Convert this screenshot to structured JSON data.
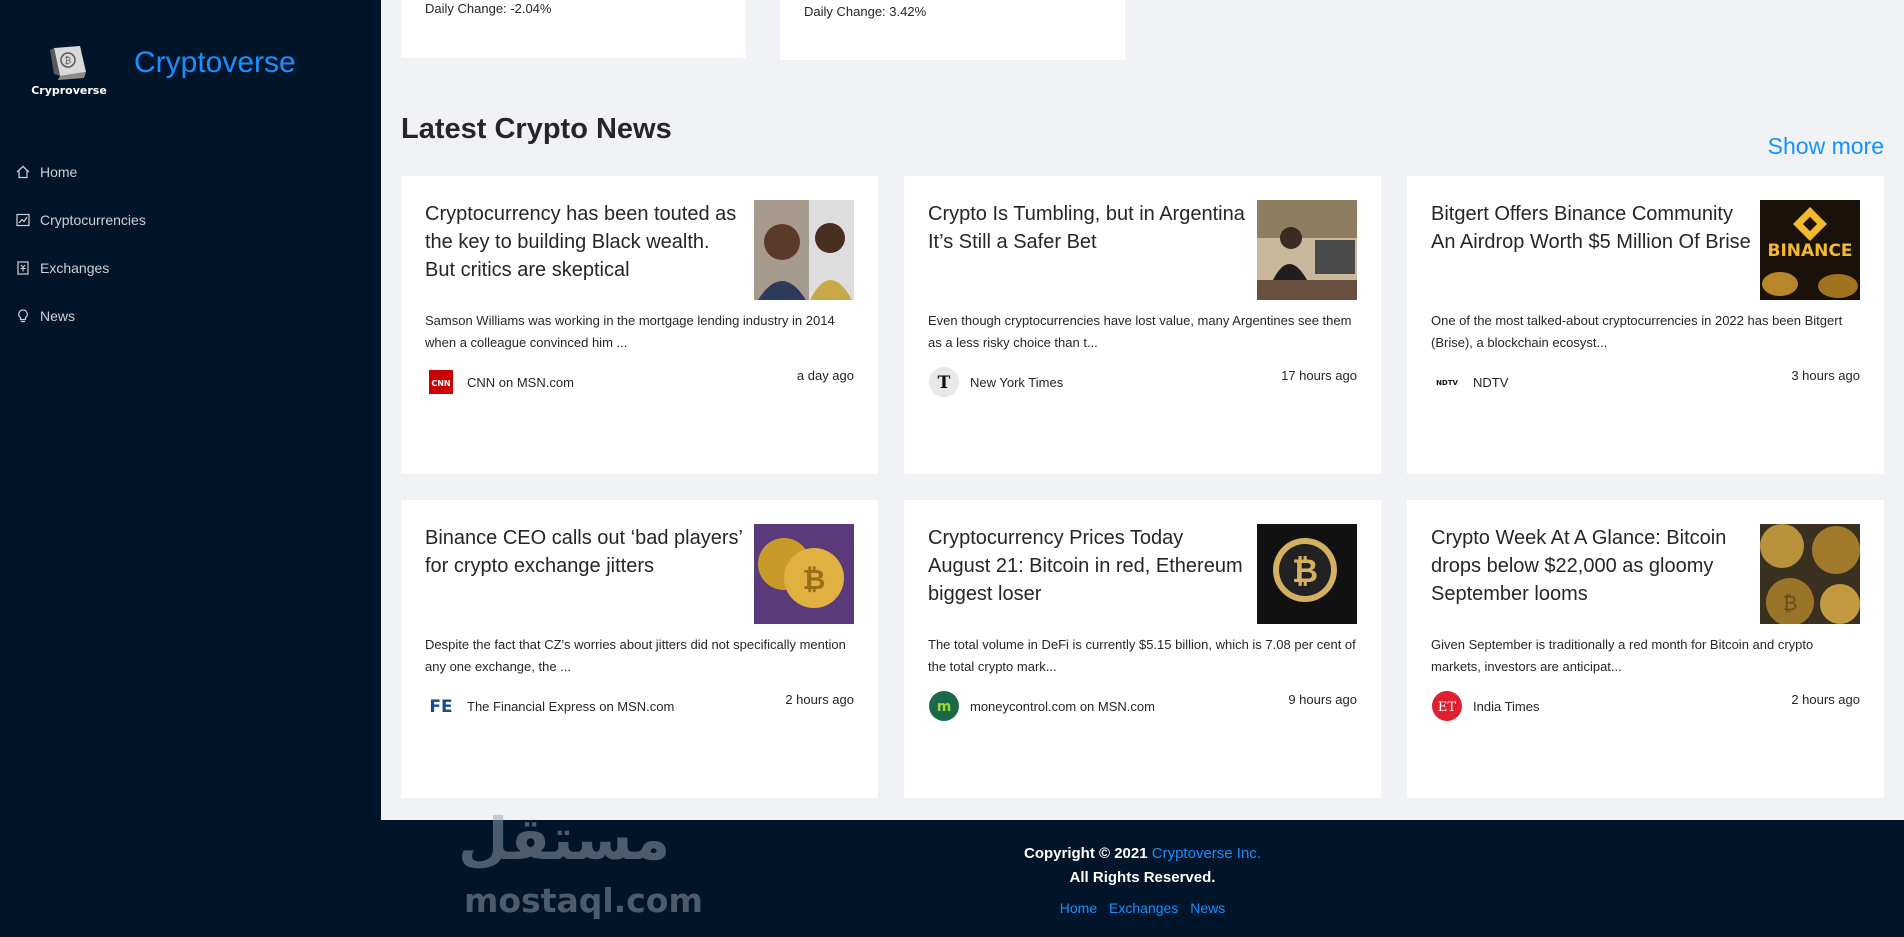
{
  "sidebar": {
    "logo_text": "Cryproverse",
    "brand": "Cryptoverse",
    "items": [
      {
        "label": "Home",
        "icon": "home-icon"
      },
      {
        "label": "Cryptocurrencies",
        "icon": "fund-icon"
      },
      {
        "label": "Exchanges",
        "icon": "money-collect-icon"
      },
      {
        "label": "News",
        "icon": "bulb-icon"
      }
    ]
  },
  "stats": [
    {
      "text": "Daily Change: -2.04%"
    },
    {
      "text": "Daily Change: 3.42%"
    }
  ],
  "news": {
    "title": "Latest Crypto News",
    "show_more": "Show more",
    "cards": [
      {
        "title": "Cryptocurrency has been touted as the key to building Black wealth. But critics are skeptical",
        "desc": "Samson Williams was working in the mortgage lending industry in 2014 when a colleague convinced him ...",
        "provider": "CNN on MSN.com",
        "provider_logo": "cnn-logo",
        "time": "a day ago"
      },
      {
        "title": "Crypto Is Tumbling, but in Argentina It’s Still a Safer Bet",
        "desc": "Even though cryptocurrencies have lost value, many Argentines see them as a less risky choice than t...",
        "provider": "New York Times",
        "provider_logo": "nyt-logo",
        "time": "17 hours ago"
      },
      {
        "title": "Bitgert Offers Binance Community An Airdrop Worth $5 Million Of Brise",
        "desc": "One of the most talked-about cryptocurrencies in 2022 has been Bitgert (Brise), a blockchain ecosyst...",
        "provider": "NDTV",
        "provider_logo": "ndtv-logo",
        "time": "3 hours ago"
      },
      {
        "title": "Binance CEO calls out ‘bad players’ for crypto exchange jitters",
        "desc": "Despite the fact that CZ's worries about jitters did not specifically mention any one exchange, the ...",
        "provider": "The Financial Express on MSN.com",
        "provider_logo": "fe-logo",
        "time": "2 hours ago"
      },
      {
        "title": "Cryptocurrency Prices Today August 21: Bitcoin in red, Ethereum biggest loser",
        "desc": "The total volume in DeFi is currently $5.15 billion, which is 7.08 per cent of the total crypto mark...",
        "provider": "moneycontrol.com on MSN.com",
        "provider_logo": "moneycontrol-logo",
        "time": "9 hours ago"
      },
      {
        "title": "Crypto Week At A Glance: Bitcoin drops below $22,000 as gloomy September looms",
        "desc": "Given September is traditionally a red month for Bitcoin and crypto markets, investors are anticipat...",
        "provider": "India Times",
        "provider_logo": "et-logo",
        "time": "2 hours ago"
      }
    ]
  },
  "footer": {
    "copyright_prefix": "Copyright © 2021",
    "copyright_link": "Cryptoverse Inc.",
    "rights": "All Rights Reserved.",
    "links": [
      "Home",
      "Exchanges",
      "News"
    ]
  },
  "watermark": {
    "arabic": "مستقل",
    "latin": "mostaql.com"
  },
  "colors": {
    "sidebar_bg": "#001529",
    "accent": "#1890ff",
    "page_bg": "#f0f2f5"
  },
  "thumbnail_labels": {
    "binance": "BINANCE",
    "cnn": "CNN",
    "ndtv": "NDTV",
    "fe": "FE",
    "et": "ET",
    "mc": "m"
  }
}
